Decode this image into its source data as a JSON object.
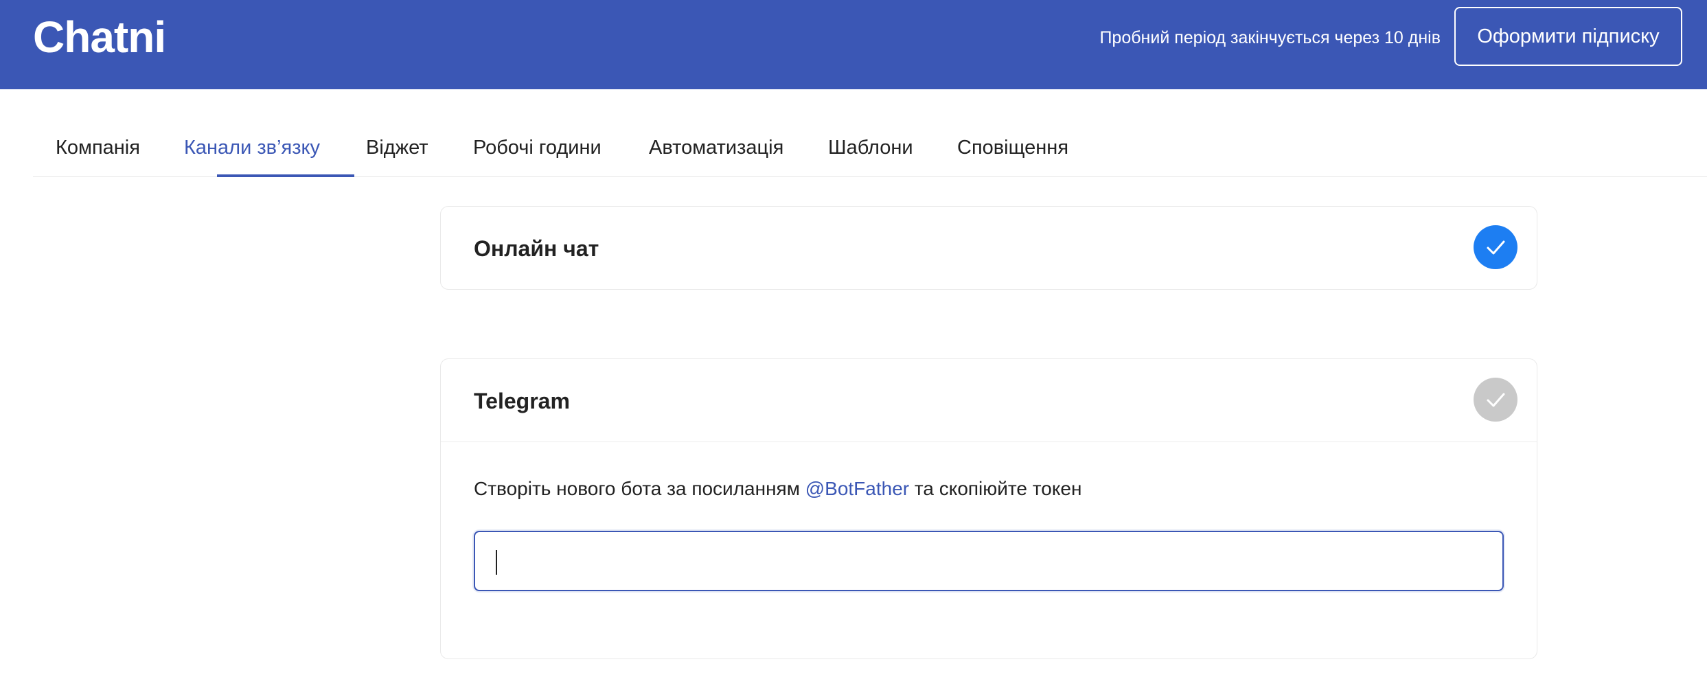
{
  "header": {
    "logo": "Chatni",
    "trial_text": "Пробний період закінчується через 10 днів",
    "subscribe_label": "Оформити підписку"
  },
  "tabs": [
    {
      "label": "Компанія",
      "active": false
    },
    {
      "label": "Канали зв’язку",
      "active": true
    },
    {
      "label": "Віджет",
      "active": false
    },
    {
      "label": "Робочі години",
      "active": false
    },
    {
      "label": "Автоматизація",
      "active": false
    },
    {
      "label": "Шаблони",
      "active": false
    },
    {
      "label": "Сповіщення",
      "active": false
    }
  ],
  "channels": {
    "online_chat": {
      "title": "Онлайн чат",
      "enabled": true
    },
    "telegram": {
      "title": "Telegram",
      "enabled": false,
      "instruction_before": "Створіть нового бота за посиланням",
      "instruction_link": "@BotFather",
      "instruction_after": "та скопіюйте токен",
      "token_value": "",
      "token_placeholder": ""
    }
  },
  "colors": {
    "brand": "#3b57b5",
    "check_on": "#1d7ef2",
    "check_off": "#c9c9c9"
  },
  "icons": {
    "check": "check-icon"
  }
}
